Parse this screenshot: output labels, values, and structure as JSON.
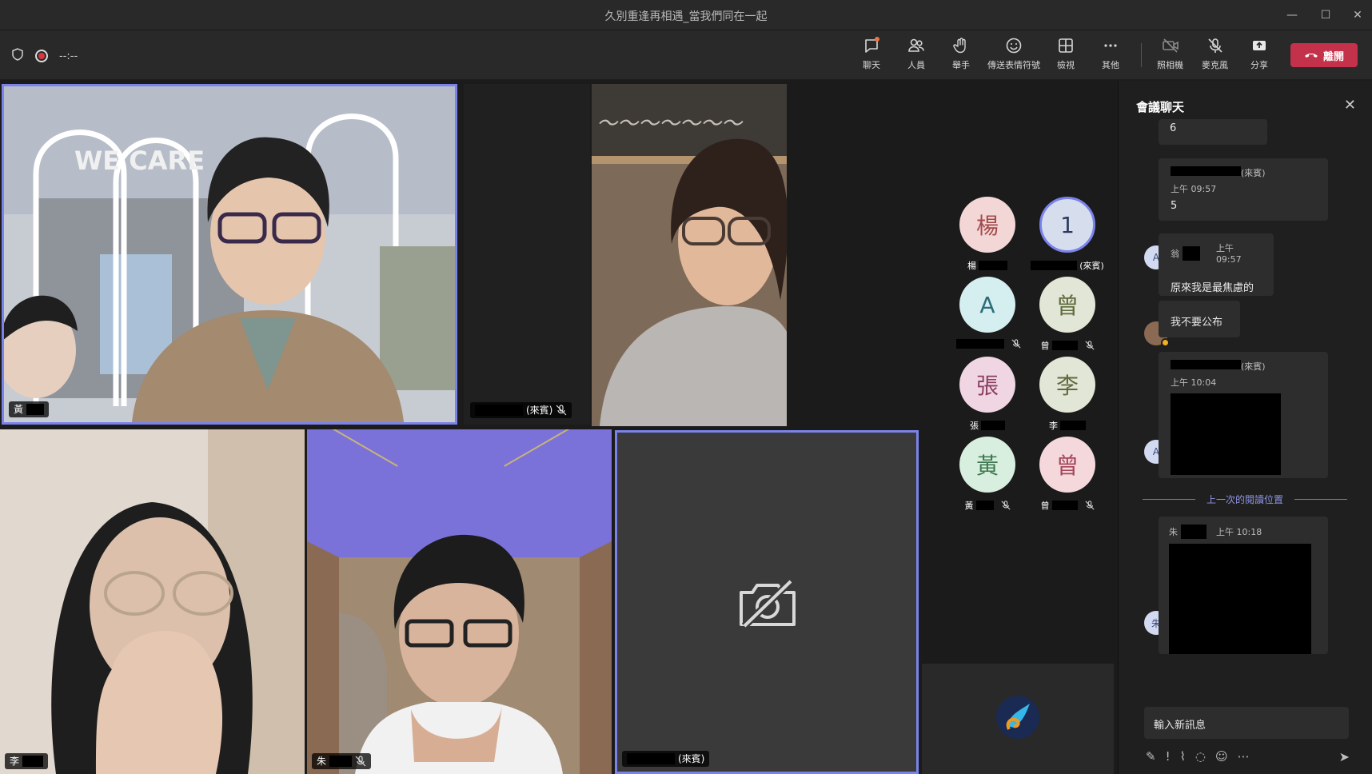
{
  "window": {
    "title": "久別重逢再相遇_當我們同在一起",
    "min": "—",
    "max": "☐",
    "close": "✕"
  },
  "toolbar": {
    "timer": "--:--",
    "chat": "聊天",
    "people": "人員",
    "raise_hand": "舉手",
    "reactions": "傳送表情符號",
    "view": "檢視",
    "more": "其他",
    "camera": "照相機",
    "mic": "麥克風",
    "share": "分享",
    "leave": "離開"
  },
  "tiles": {
    "t1_name": "黃",
    "t2_name": "(來賓)",
    "t4_name": "李",
    "t5_name": "朱",
    "t6_name": "(來賓)"
  },
  "avatars": [
    {
      "initial": "楊",
      "label": "楊",
      "bg": "#f3d6d6",
      "fg": "#a44a4a"
    },
    {
      "initial": "1",
      "label": "(來賓)",
      "bg": "#d6deee",
      "fg": "#2c3a5e"
    },
    {
      "initial": "A",
      "label": "",
      "bg": "#d5eef0",
      "fg": "#2d6c76"
    },
    {
      "initial": "曾",
      "label": "曾",
      "bg": "#e2e6d6",
      "fg": "#5e6a3e"
    },
    {
      "initial": "張",
      "label": "張",
      "bg": "#f0d6e2",
      "fg": "#8a3e63"
    },
    {
      "initial": "李",
      "label": "李",
      "bg": "#e2e6d6",
      "fg": "#5e6a3e"
    },
    {
      "initial": "黃",
      "label": "黃",
      "bg": "#d8efdf",
      "fg": "#3e7a50"
    },
    {
      "initial": "曾",
      "label": "曾",
      "bg": "#f5d8dc",
      "fg": "#a4475b"
    }
  ],
  "chat": {
    "title": "會議聊天",
    "m0_text": "6",
    "m1_guest": "(來賓)",
    "m1_time": "上午 09:57",
    "m1_text": "5",
    "m1_av": "A",
    "m2_name": "翁",
    "m2_time": "上午 09:57",
    "m2_text": "原來我是最焦慮的",
    "m3_text": "我不要公布",
    "m4_guest": "(來賓)",
    "m4_time": "上午 10:04",
    "m4_av": "A",
    "last_read": "上一次的閱讀位置",
    "m5_name": "朱",
    "m5_time": "上午 10:18",
    "m5_av": "朱",
    "compose_placeholder": "輸入新訊息"
  },
  "colors": {
    "accent": "#7b83eb",
    "leave": "#c4314b",
    "panel": "#1f1f1f"
  }
}
